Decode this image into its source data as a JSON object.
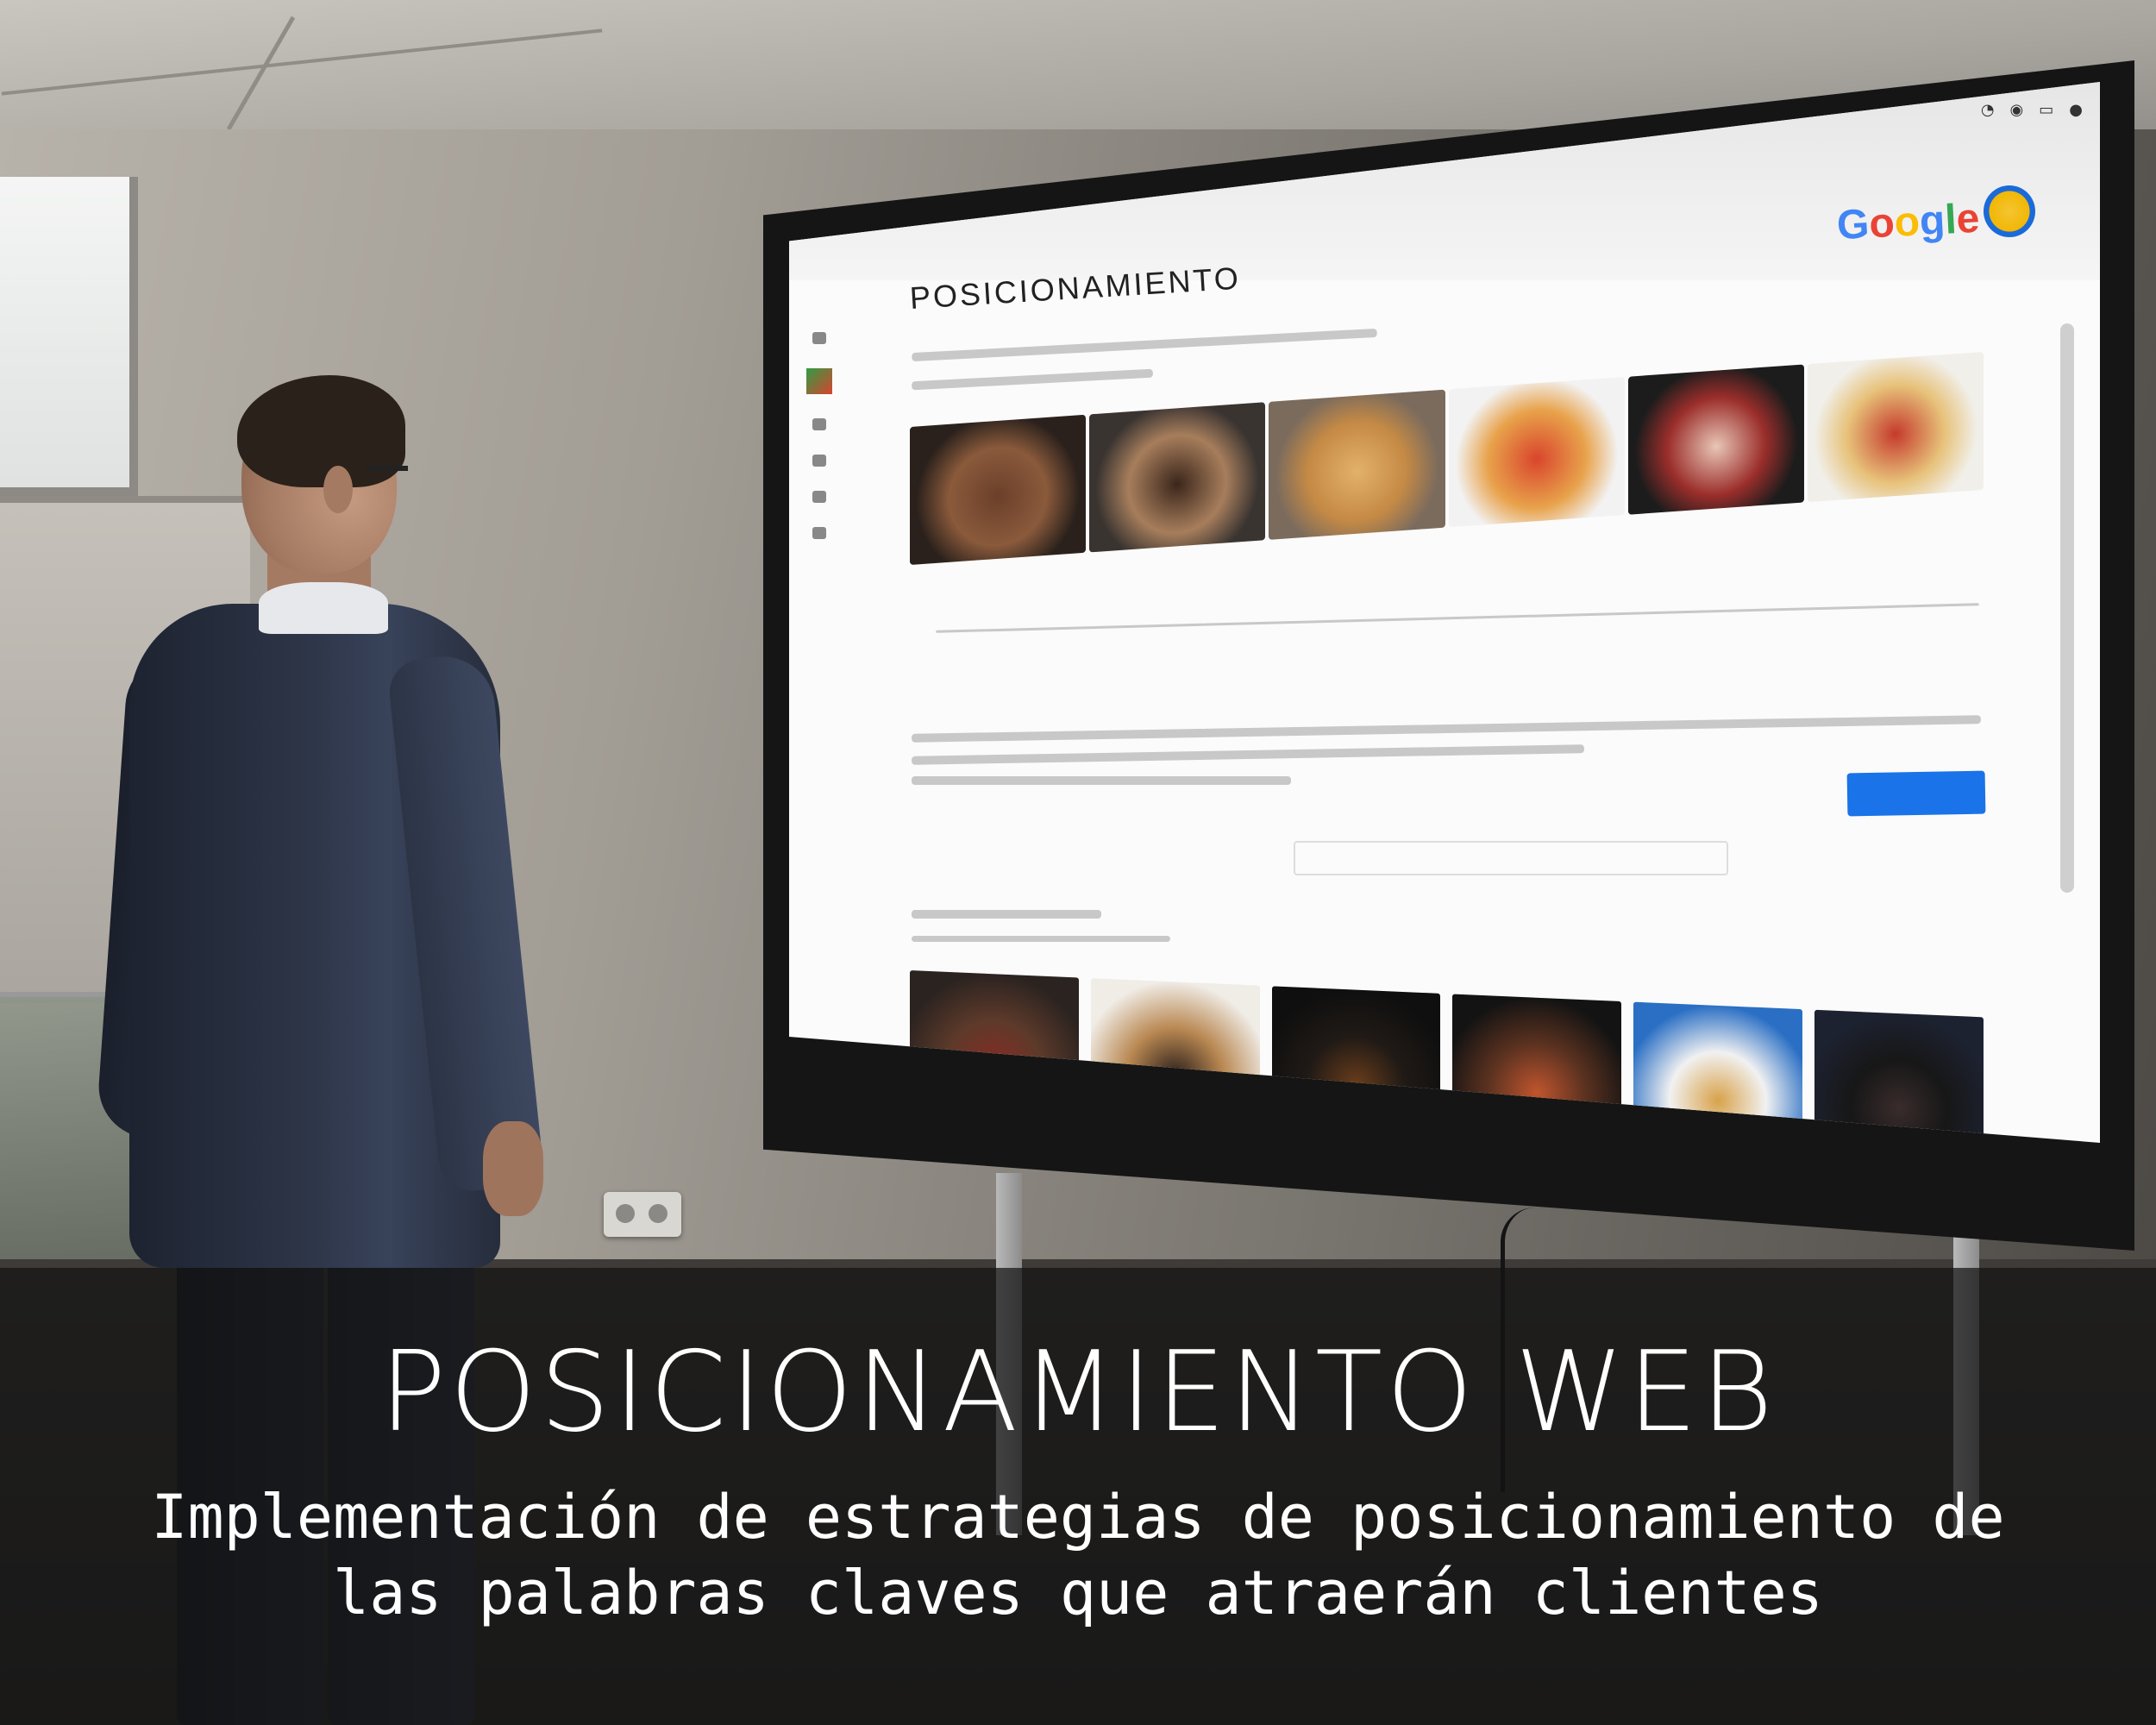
{
  "overlay": {
    "title": "POSICIONAMIENTO WEB",
    "subtitle": "Implementación de estrategias de posicionamiento de las palabras claves que atraerán clientes"
  },
  "screen": {
    "page_heading": "POSICIONAMIENTO",
    "logo_text": "Google"
  },
  "colors": {
    "caption_text": "#ffffff",
    "caption_band": "#141414",
    "google_blue": "#4285f4",
    "google_red": "#ea4335",
    "google_yellow": "#fbbc05",
    "google_green": "#34a853",
    "button_blue": "#1a73e8"
  }
}
